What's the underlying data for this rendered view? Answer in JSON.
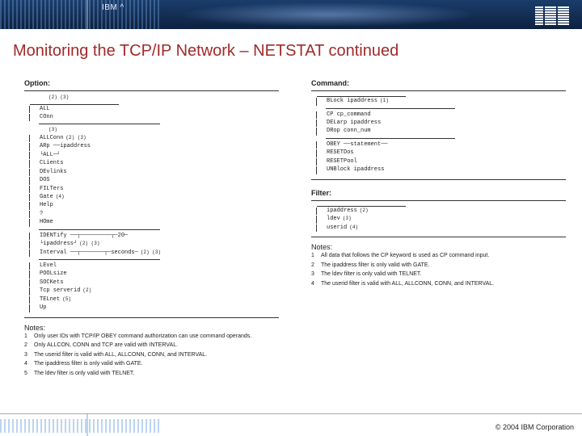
{
  "header": {
    "product": "IBM ^",
    "logo_alt": "IBM"
  },
  "title": "Monitoring the TCP/IP Network – NETSTAT continued",
  "left": {
    "section": "Option:",
    "top_ref": "(2)  (3)",
    "options": [
      {
        "txt": "ALL"
      },
      {
        "txt": "COnn",
        "sup": ""
      },
      {
        "txt": "",
        "divider": true,
        "sup": "(3)"
      },
      {
        "txt": "ALLConn",
        "sup": "(2)  (3)"
      },
      {
        "txt": "ARp ──ipaddress"
      },
      {
        "txt": "    └ALL─┘"
      },
      {
        "txt": "CLients"
      },
      {
        "txt": "DEvlinks"
      },
      {
        "txt": "DOS"
      },
      {
        "txt": "FILTers"
      },
      {
        "txt": "Gate",
        "sup": "(4)"
      },
      {
        "txt": "Help"
      },
      {
        "txt": "?"
      },
      {
        "txt": "HOme"
      },
      {
        "txt": "IDENTify ──┬─────────┬─20─"
      },
      {
        "txt": "           └ipaddress┘",
        "sup": "(2)  (3)"
      },
      {
        "txt": "Interval ──┬───────┬─seconds─",
        "sup": "(2)  (3)"
      },
      {
        "txt": "LEvel"
      },
      {
        "txt": "POOLsize"
      },
      {
        "txt": "SOCKets"
      },
      {
        "txt": "Tcp serverid",
        "sup": "(2)"
      },
      {
        "txt": "TELnet",
        "sup": "(5)"
      },
      {
        "txt": "Up"
      }
    ],
    "notes_label": "Notes:",
    "notes": [
      "Only user IDs with TCP/IP OBEY command authorization can use command operands.",
      "Only ALLCON, CONN and TCP are valid with INTERVAL.",
      "The userid filter is valid with ALL, ALLCONN, CONN, and INTERVAL.",
      "The ipaddress filter is only valid with GATE.",
      "The ldev filter is only valid with TELNET."
    ]
  },
  "right": {
    "cmd_section": "Command:",
    "commands": [
      {
        "txt": "BLock ipaddress",
        "sup": "(1)"
      },
      {
        "txt": "CP cp_command"
      },
      {
        "txt": "DELarp ipaddress"
      },
      {
        "txt": "DRop conn_num"
      },
      {
        "txt": "OBEY ──statement──"
      },
      {
        "txt": "RESETDos"
      },
      {
        "txt": "RESETPool"
      },
      {
        "txt": "UNBlock ipaddress"
      }
    ],
    "filter_section": "Filter:",
    "filters": [
      {
        "txt": "ipaddress",
        "sup": "(2)"
      },
      {
        "txt": "ldev",
        "sup": "(3)"
      },
      {
        "txt": "userid",
        "sup": "(4)"
      }
    ],
    "notes_label": "Notes:",
    "notes": [
      "All data that follows the CP keyword is used as CP command input.",
      "The ipaddress filter is only valid with GATE.",
      "The ldev filter is only valid with TELNET.",
      "The userid filter is valid with ALL, ALLCONN, CONN, and INTERVAL."
    ]
  },
  "footer": {
    "copyright": "© 2004 IBM Corporation"
  }
}
